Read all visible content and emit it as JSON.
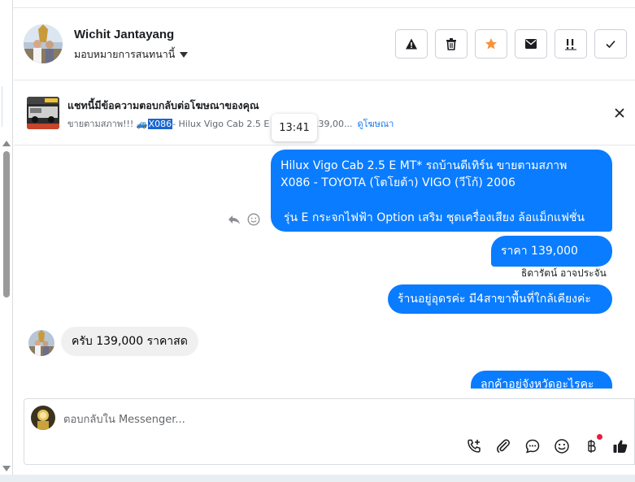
{
  "header": {
    "contact_name": "Wichit Jantayang",
    "assign_label": "มอบหมายการสนทนานี้",
    "actions": [
      {
        "name": "warning-icon",
        "label": "Spam"
      },
      {
        "name": "trash-icon",
        "label": "Delete"
      },
      {
        "name": "star-icon",
        "label": "Star",
        "color": "#f7923a"
      },
      {
        "name": "envelope-icon",
        "label": "Mark unread"
      },
      {
        "name": "priority-icon",
        "label": "Follow up"
      },
      {
        "name": "check-icon",
        "label": "Done"
      }
    ]
  },
  "ad_context": {
    "title": "แชทนี้มีข้อความตอบกลับต่อโฆษณาของคุณ",
    "text_before": "ขายตามสภาพ!!! 🚙 ",
    "highlight": "X086",
    "text_after": " - Hilux Vigo Cab 2.5 E",
    "text_price": "าคา 139,00...",
    "link": "ดูโฆษณา"
  },
  "tooltip": {
    "time": "13:41"
  },
  "messages": {
    "m1_line1": "Hilux Vigo Cab 2.5 E MT* รถบ้านดีเทิร์น ขายตามสภาพ",
    "m1_line2": "X086 - TOYOTA (โตโยต้า) VIGO (วีโก้) 2006",
    "m1_line3": "รุ่น E กระจกไฟฟ้า Option เสริม ชุดเครื่องเสียง ล้อแม็กแฟชั่น",
    "m2": "ราคา 139,000 บาท",
    "sender": "ธิดารัตน์ อาจประจัน",
    "m3": "ร้านอยู่อุดรค่ะ มี4สาขาพื้นที่ใกล้เคียงค่ะ",
    "incoming": "ครับ 139,000 ราคาสด",
    "m4": "ลูกค้าอยู่จังหวัดอะไรคะ"
  },
  "composer": {
    "placeholder": "ตอบกลับใน Messenger...",
    "tools": [
      "phone-plus-icon",
      "paperclip-icon",
      "chat-bubble-icon",
      "smiley-icon",
      "baht-icon",
      "thumbs-up-icon"
    ]
  },
  "colors": {
    "outgoing_bubble": "#0a7cff",
    "incoming_bubble": "#f0f0f0",
    "link": "#1877f2",
    "highlight": "#1a66d1"
  }
}
